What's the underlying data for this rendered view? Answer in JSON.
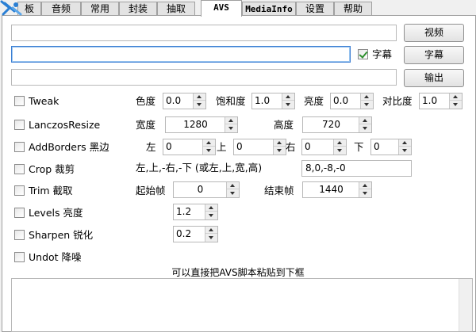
{
  "tabs": [
    {
      "label": "板",
      "active": false
    },
    {
      "label": "音频",
      "active": false
    },
    {
      "label": "常用",
      "active": false
    },
    {
      "label": "封装",
      "active": false
    },
    {
      "label": "抽取",
      "active": false
    },
    {
      "label": "AVS",
      "active": true
    },
    {
      "label": "MediaInfo",
      "active": false
    },
    {
      "label": "设置",
      "active": false
    },
    {
      "label": "帮助",
      "active": false
    }
  ],
  "files": {
    "video_value": "",
    "video_button": "视频",
    "subtitle_value": "",
    "subtitle_checkbox_label": "字幕",
    "subtitle_checked": true,
    "subtitle_button": "字幕",
    "output_value": "",
    "output_button": "输出"
  },
  "filters": {
    "tweak": {
      "label": "Tweak",
      "checked": false,
      "hue_label": "色度",
      "hue": "0.0",
      "sat_label": "饱和度",
      "sat": "1.0",
      "bright_label": "亮度",
      "bright": "0.0",
      "cont_label": "对比度",
      "cont": "1.0"
    },
    "lanczos": {
      "label": "LanczosResize",
      "checked": false,
      "width_label": "宽度",
      "width": "1280",
      "height_label": "高度",
      "height": "720"
    },
    "addborders": {
      "label": "AddBorders 黑边",
      "checked": false,
      "left_label": "左",
      "left": "0",
      "top_label": "上",
      "top": "0",
      "right_label": "右",
      "right": "0",
      "bottom_label": "下",
      "bottom": "0"
    },
    "crop": {
      "label": "Crop 裁剪",
      "checked": false,
      "desc": "左,上,-右,-下 (或左,上,宽,高)",
      "value": "8,0,-8,-0"
    },
    "trim": {
      "label": "Trim 截取",
      "checked": false,
      "start_label": "起始帧",
      "start": "0",
      "end_label": "结束帧",
      "end": "1440"
    },
    "levels": {
      "label": "Levels 亮度",
      "checked": false,
      "value": "1.2"
    },
    "sharpen": {
      "label": "Sharpen 锐化",
      "checked": false,
      "value": "0.2"
    },
    "undot": {
      "label": "Undot 降噪",
      "checked": false
    }
  },
  "script": {
    "hint": "可以直接把AVS脚本粘贴到下框",
    "content": ""
  },
  "colors": {
    "focus_border": "#3d7fd3",
    "check": "#2f8f2f",
    "logo": "#2a7fd4"
  }
}
